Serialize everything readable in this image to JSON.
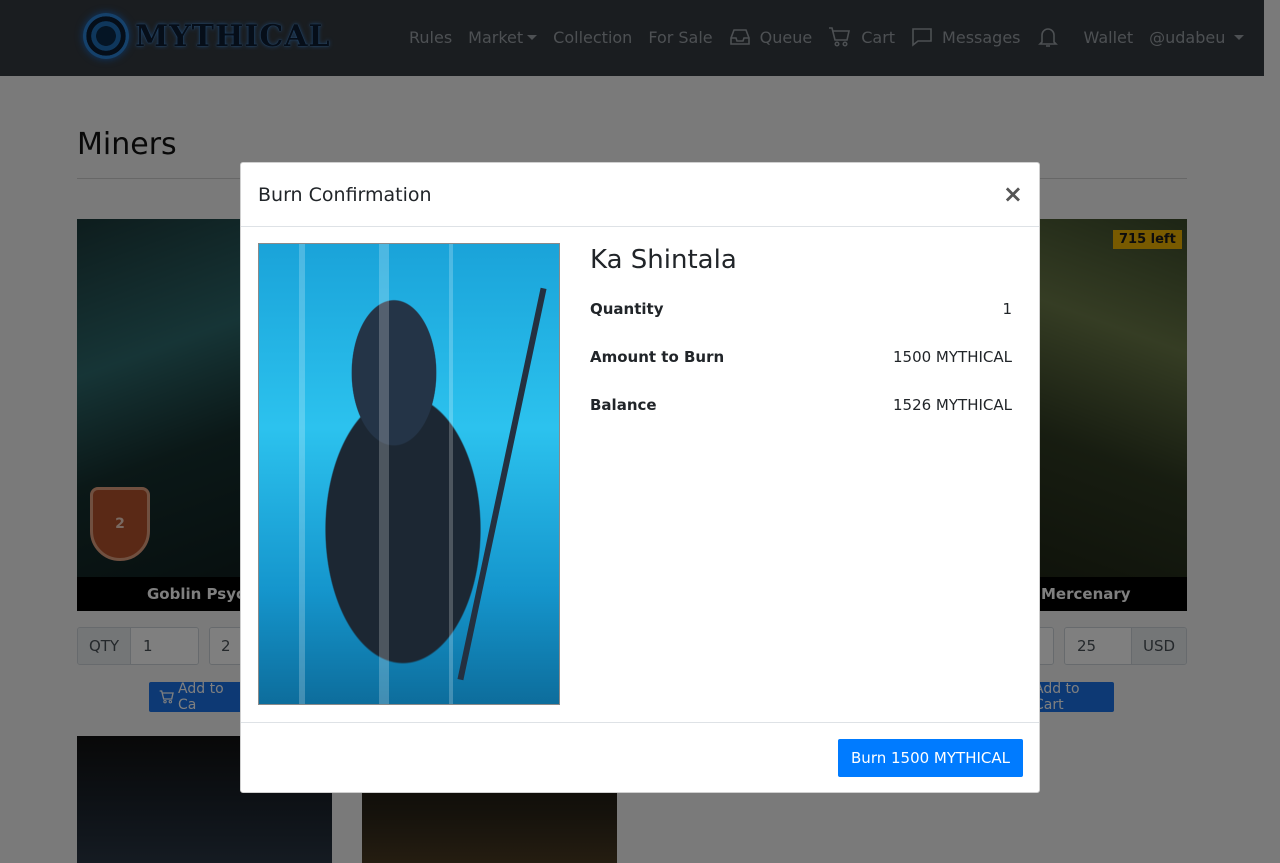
{
  "navbar": {
    "brand": "MYTHICAL",
    "items": [
      {
        "label": "Rules",
        "icon": ""
      },
      {
        "label": "Market",
        "icon": "",
        "dropdown": true
      },
      {
        "label": "Collection",
        "icon": ""
      },
      {
        "label": "For Sale",
        "icon": ""
      },
      {
        "label": "Queue",
        "icon": "inbox-icon"
      },
      {
        "label": "Cart",
        "icon": "cart-icon"
      },
      {
        "label": "Messages",
        "icon": "chat-icon"
      },
      {
        "label": "",
        "icon": "bell-icon"
      },
      {
        "label": "Wallet",
        "icon": ""
      },
      {
        "label": "@udabeu",
        "icon": "",
        "dropdown": true
      }
    ]
  },
  "page": {
    "title": "Miners",
    "cards": [
      {
        "name": "Goblin Psych",
        "level": "2",
        "qty_label": "QTY",
        "qty_value": "1",
        "price_value": "2",
        "add_label": "Add to Ca"
      },
      {
        "name": "Mercenary",
        "badge": "715 left",
        "price_value": "25",
        "currency": "USD",
        "add_label": "Add to Cart"
      }
    ]
  },
  "modal": {
    "title": "Burn Confirmation",
    "close_symbol": "×",
    "character_name": "Ka Shintala",
    "details": [
      {
        "key": "Quantity",
        "value": "1"
      },
      {
        "key": "Amount to Burn",
        "value": "1500 MYTHICAL"
      },
      {
        "key": "Balance",
        "value": "1526 MYTHICAL"
      }
    ],
    "burn_button": "Burn 1500 MYTHICAL"
  },
  "colors": {
    "navbar": "#343a40",
    "primary": "#007bff",
    "badge": "#f0b400",
    "shield": "#b5532d"
  }
}
